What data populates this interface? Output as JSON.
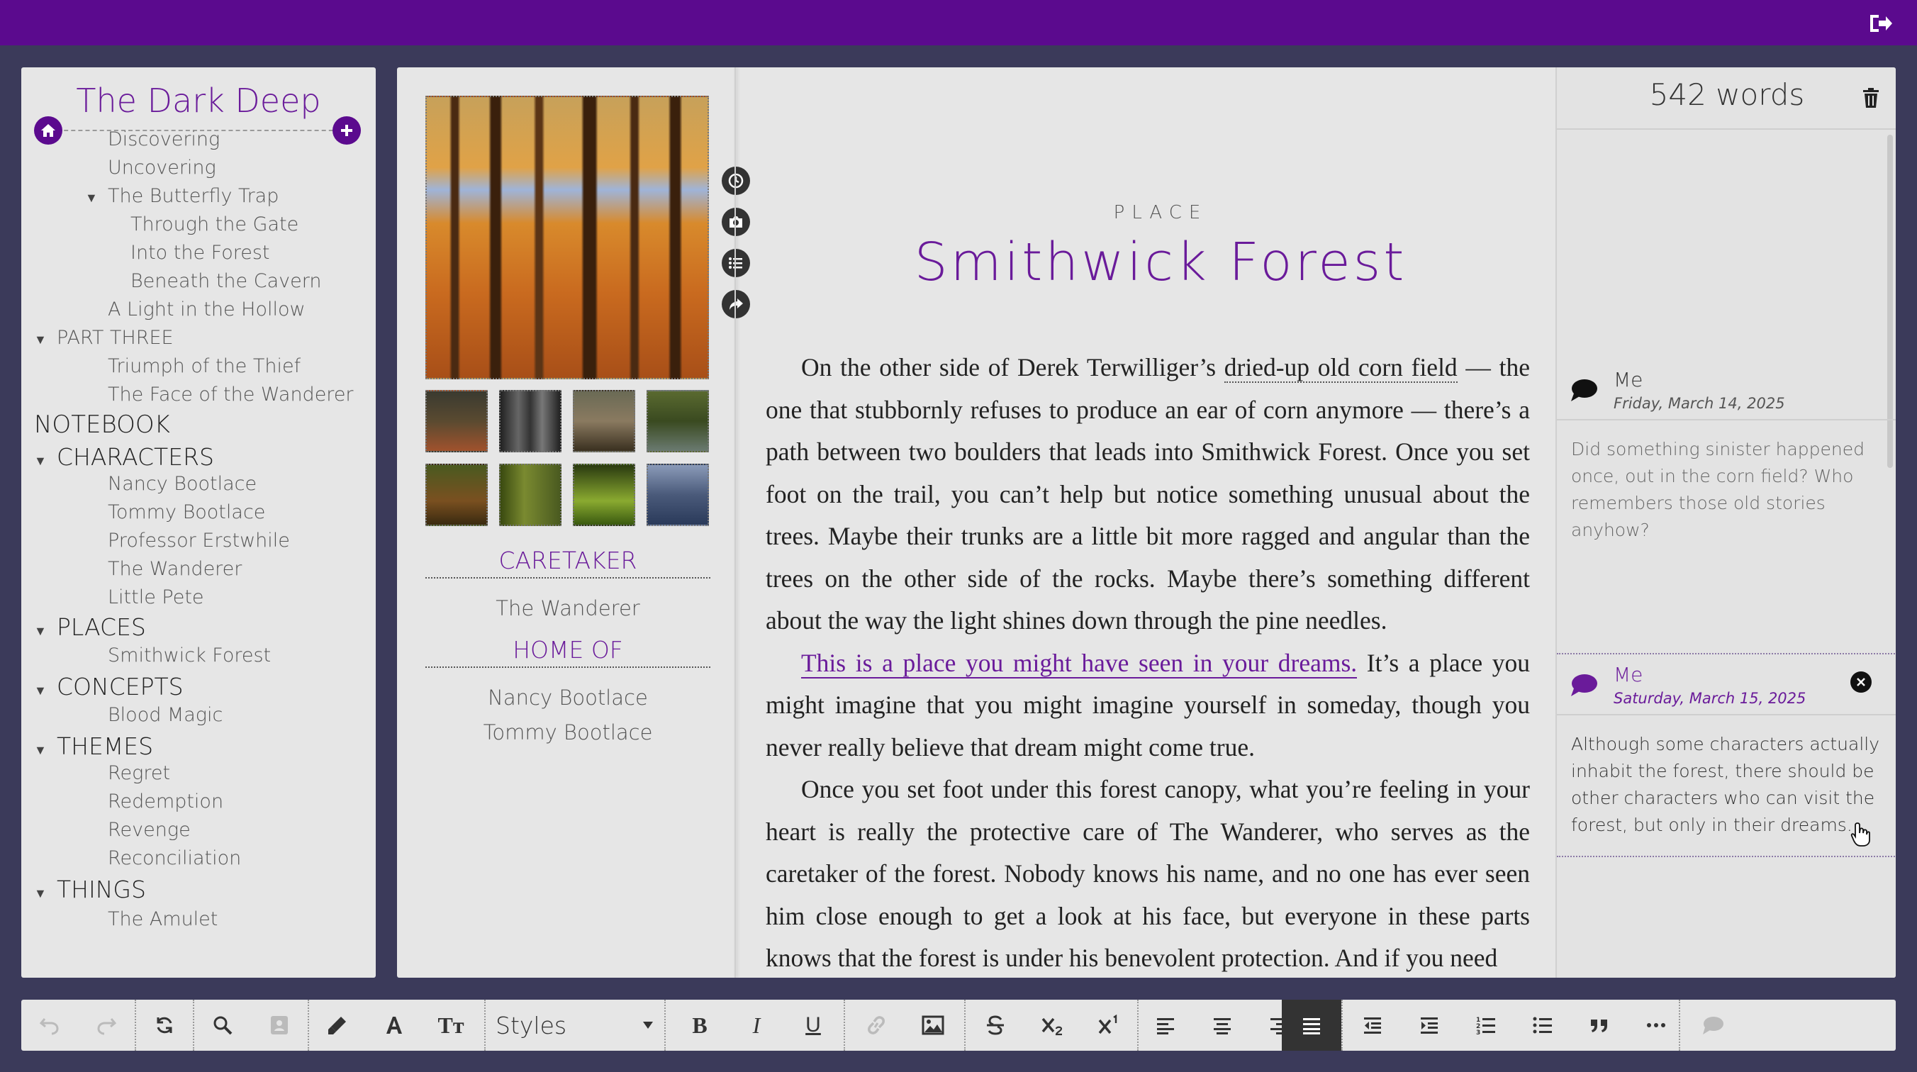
{
  "app": {
    "project_title": "The Dark Deep"
  },
  "sidebar": {
    "items": [
      {
        "label": "Discovering",
        "level": 3,
        "toggle": ""
      },
      {
        "label": "Uncovering",
        "level": 3,
        "toggle": ""
      },
      {
        "label": "The Butterfly Trap",
        "level": 3,
        "toggle": "▼"
      },
      {
        "label": "Through the Gate",
        "level": 4,
        "toggle": ""
      },
      {
        "label": "Into the Forest",
        "level": 4,
        "toggle": ""
      },
      {
        "label": "Beneath the Cavern",
        "level": 4,
        "toggle": ""
      },
      {
        "label": "A Light in the Hollow",
        "level": 3,
        "toggle": ""
      },
      {
        "label": "PART THREE",
        "level": 2,
        "toggle": "▼"
      },
      {
        "label": "Triumph of the Thief",
        "level": 3,
        "toggle": ""
      },
      {
        "label": "The Face of the Wanderer",
        "level": 3,
        "toggle": ""
      },
      {
        "label": "NOTEBOOK",
        "level": 1,
        "toggle": "▼"
      },
      {
        "label": "CHARACTERS",
        "level": 2,
        "toggle": "▼"
      },
      {
        "label": "Nancy Bootlace",
        "level": 3,
        "toggle": ""
      },
      {
        "label": "Tommy Bootlace",
        "level": 3,
        "toggle": ""
      },
      {
        "label": "Professor Erstwhile",
        "level": 3,
        "toggle": ""
      },
      {
        "label": "The Wanderer",
        "level": 3,
        "toggle": ""
      },
      {
        "label": "Little Pete",
        "level": 3,
        "toggle": ""
      },
      {
        "label": "PLACES",
        "level": 2,
        "toggle": "▼"
      },
      {
        "label": "Smithwick Forest",
        "level": 3,
        "toggle": "",
        "selected": true
      },
      {
        "label": "CONCEPTS",
        "level": 2,
        "toggle": "▼"
      },
      {
        "label": "Blood Magic",
        "level": 3,
        "toggle": ""
      },
      {
        "label": "THEMES",
        "level": 2,
        "toggle": "▼"
      },
      {
        "label": "Regret",
        "level": 3,
        "toggle": ""
      },
      {
        "label": "Redemption",
        "level": 3,
        "toggle": ""
      },
      {
        "label": "Revenge",
        "level": 3,
        "toggle": ""
      },
      {
        "label": "Reconciliation",
        "level": 3,
        "toggle": ""
      },
      {
        "label": "THINGS",
        "level": 2,
        "toggle": "▼"
      },
      {
        "label": "The Amulet",
        "level": 3,
        "toggle": ""
      }
    ]
  },
  "details": {
    "caretaker_label": "CARETAKER",
    "caretaker_value": "The Wanderer",
    "home_of_label": "HOME OF",
    "home_of_values": [
      "Nancy Bootlace",
      "Tommy Bootlace"
    ]
  },
  "document": {
    "kicker": "PLACE",
    "title": "Smithwick Forest",
    "p1_a": "On the other side of Derek Terwilliger’s ",
    "p1_link": "dried-up old corn field",
    "p1_b": " — the one that stubbornly refuses to produce an ear of corn anymore — there’s a path between two boulders that leads into Smithwick Forest. Once you set foot on the trail, you can’t help but notice something unusual about the trees. Maybe their trunks are a little bit more ragged and angular than the trees on the other side of the rocks. Maybe there’s something different about the way the light shines down through the pine needles.",
    "p2_link": "This is a place you might have seen in your dreams.",
    "p2_b": " It’s a place you might imagine that you might imagine yourself in someday, though you never really believe that dream might come true.",
    "p3": "Once you set foot under this forest canopy, what you’re feeling in your heart is really the protective care of The Wanderer, who serves as the caretaker of the forest. Nobody knows his name, and no one has ever seen him close enough to get a look at his face, but everyone in these parts knows that the forest is under his benevolent protection. And if you need"
  },
  "comments": {
    "word_count": "542 words",
    "items": [
      {
        "author": "Me",
        "date": "Friday, March 14, 2025",
        "text": "Did something sinister happened once, out in the corn field? Who remembers those old stories anyhow?"
      },
      {
        "author": "Me",
        "date": "Saturday, March 15, 2025",
        "text": "Although some characters actually inhabit the forest, there should be other characters who can visit the forest, but only in their dreams."
      }
    ]
  },
  "toolbar": {
    "styles_label": "Styles",
    "bold": "B",
    "italic": "I",
    "underline": "U",
    "font_size": "Tт"
  },
  "colors": {
    "brand": "#5b0a8e",
    "accent_text": "#6a1b9a"
  }
}
